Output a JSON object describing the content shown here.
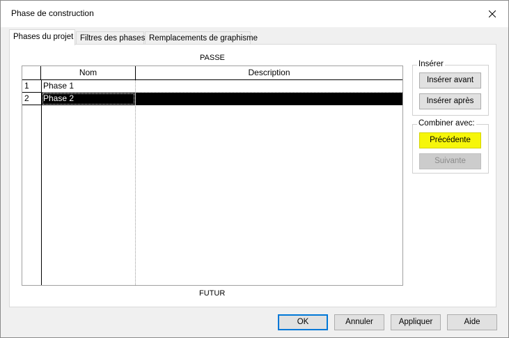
{
  "window": {
    "title": "Phase de construction",
    "close_icon": "close-icon"
  },
  "tabs": [
    {
      "label": "Phases du projet",
      "active": true
    },
    {
      "label": "Filtres des phases",
      "active": false
    },
    {
      "label": "Remplacements de graphisme",
      "active": false
    }
  ],
  "grid": {
    "top_caption": "PASSE",
    "bottom_caption": "FUTUR",
    "columns": [
      "Nom",
      "Description"
    ],
    "rows": [
      {
        "number": "1",
        "name": "Phase 1",
        "description": "",
        "selected": false
      },
      {
        "number": "2",
        "name": "Phase 2",
        "description": "",
        "selected": true
      }
    ]
  },
  "insert_group": {
    "label": "Insérer",
    "before_label": "Insérer avant",
    "after_label": "Insérer après"
  },
  "combine_group": {
    "label": "Combiner avec:",
    "previous_label": "Précédente",
    "next_label": "Suivante",
    "highlight_color": "#f6f60a"
  },
  "footer": {
    "ok_label": "OK",
    "cancel_label": "Annuler",
    "apply_label": "Appliquer",
    "help_label": "Aide"
  }
}
